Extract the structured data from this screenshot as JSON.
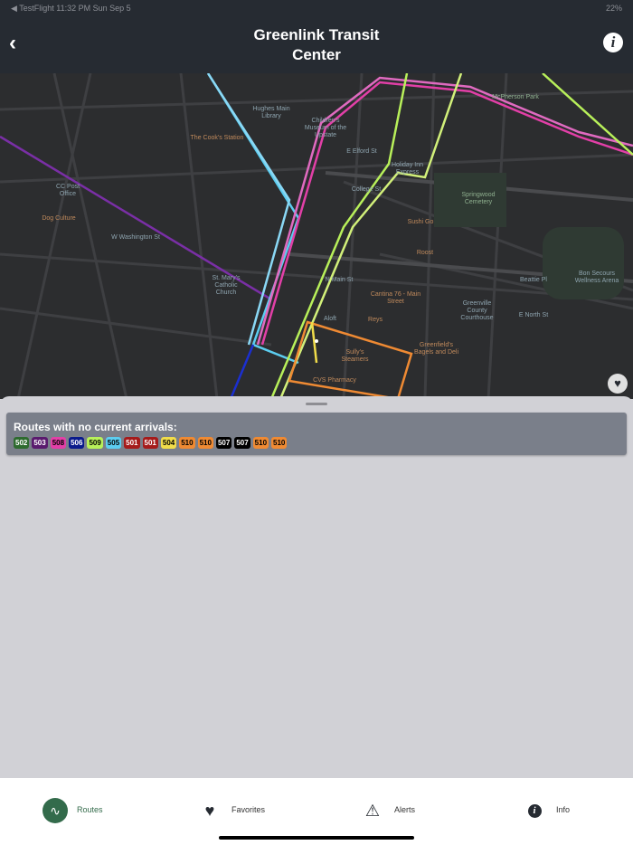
{
  "status": {
    "left": "◀ TestFlight   11:32 PM   Sun Sep 5",
    "right": "22%"
  },
  "header": {
    "title_line1": "Greenlink Transit",
    "title_line2": "Center",
    "back_icon": "chevron-left-icon",
    "info_icon": "info-icon"
  },
  "map": {
    "labels": [
      "Hughes Main Library",
      "McPherson Park",
      "Children's Museum of the Upstate",
      "The Cook's Station",
      "Holiday Inn Express",
      "Springwood Cemetery",
      "Sushi Go",
      "Roost",
      "Dog Culture",
      "St. Mary's Catholic Church",
      "Cantina 76 - Main Street",
      "Reys",
      "Greenville County Courthouse",
      "Bon Secours Wellness Arena",
      "Greenfield's Bagels and Deli",
      "Sully's Steamers",
      "CVS Pharmacy",
      "Aloft",
      "CC Post Office",
      "E North St",
      "Beattie Pl",
      "College St",
      "E Elford St",
      "W Washington St",
      "N Main St"
    ]
  },
  "sheet": {
    "card_title": "Routes with no current arrivals:",
    "routes": [
      {
        "n": "502",
        "bg": "#2e6b2f",
        "fg": "#fff"
      },
      {
        "n": "503",
        "bg": "#5a1a6e",
        "fg": "#fff"
      },
      {
        "n": "508",
        "bg": "#e23fa7",
        "fg": "#000"
      },
      {
        "n": "506",
        "bg": "#0a1a8c",
        "fg": "#fff"
      },
      {
        "n": "509",
        "bg": "#b8f05a",
        "fg": "#000"
      },
      {
        "n": "505",
        "bg": "#5ccdf0",
        "fg": "#000"
      },
      {
        "n": "501",
        "bg": "#a51b1b",
        "fg": "#fff"
      },
      {
        "n": "501",
        "bg": "#a51b1b",
        "fg": "#fff"
      },
      {
        "n": "504",
        "bg": "#f0dc4a",
        "fg": "#000"
      },
      {
        "n": "510",
        "bg": "#ef8a33",
        "fg": "#000"
      },
      {
        "n": "510",
        "bg": "#ef8a33",
        "fg": "#000"
      },
      {
        "n": "507",
        "bg": "#000000",
        "fg": "#fff"
      },
      {
        "n": "507",
        "bg": "#000000",
        "fg": "#fff"
      },
      {
        "n": "510",
        "bg": "#ef8a33",
        "fg": "#000"
      },
      {
        "n": "510",
        "bg": "#ef8a33",
        "fg": "#000"
      }
    ]
  },
  "tabs": [
    {
      "label": "Routes",
      "icon": "route-icon",
      "active": true
    },
    {
      "label": "Favorites",
      "icon": "heart-icon"
    },
    {
      "label": "Alerts",
      "icon": "warning-icon"
    },
    {
      "label": "Info",
      "icon": "info-icon"
    }
  ],
  "colors": {
    "accent": "#336b4b",
    "header_bg": "#262b32"
  }
}
